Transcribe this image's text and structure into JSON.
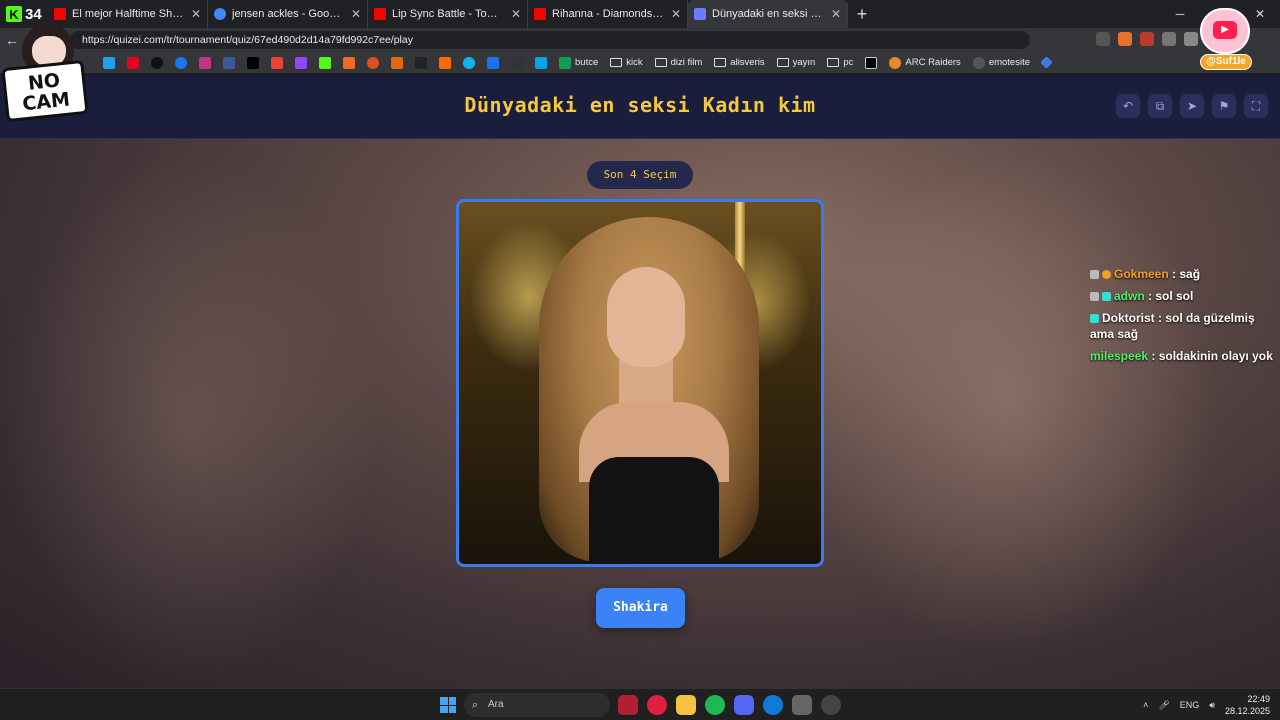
{
  "kick_badge": {
    "number": "34"
  },
  "tabs": [
    {
      "title": "El mejor Halftime Show Super Bow",
      "color": "#ff0000"
    },
    {
      "title": "jensen ackles - Google'da Ara",
      "color": "#4285f4"
    },
    {
      "title": "Lip Sync Battle - Tom Holland - Yo",
      "color": "#ff0000"
    },
    {
      "title": "Rihanna - Diamonds Live Victoria'",
      "color": "#ff0000"
    },
    {
      "title": "Dünyadaki en seksi Kadın kim - Ti",
      "color": "#6a7cff",
      "active": true
    }
  ],
  "address": {
    "url": "https://quizei.com/tr/tournament/quiz/67ed490d2d14a79fd992c7ee/play"
  },
  "bookmarks": [
    {
      "label": "butce",
      "type": "icon",
      "color": "#0f9d58"
    },
    {
      "label": "kick",
      "type": "folder"
    },
    {
      "label": "dizi film",
      "type": "folder"
    },
    {
      "label": "alisveris",
      "type": "folder"
    },
    {
      "label": "yayın",
      "type": "folder"
    },
    {
      "label": "pc",
      "type": "folder"
    },
    {
      "label": "ARC Raiders",
      "type": "icon",
      "color": "#e08a2a"
    },
    {
      "label": "emotesite",
      "type": "icon",
      "color": "#555555"
    }
  ],
  "quiz": {
    "title": "Dünyadaki en seksi Kadın kim",
    "round_label": "Son 4 Seçim",
    "candidate_name": "Shakira"
  },
  "chat": [
    {
      "user": "Gokmeen",
      "message": " : sağ"
    },
    {
      "user": "adwn",
      "message": " : sol sol"
    },
    {
      "user": "Doktorist",
      "message": " : sol da güzelmiş ama sağ"
    },
    {
      "user": "milespeek",
      "message": " : soldakinin olayı yok"
    }
  ],
  "overlay": {
    "nocam_text": "NO CAM",
    "handle": "@Suf1le"
  },
  "taskbar": {
    "search_placeholder": "Ara",
    "lang": "ENG",
    "time": "22:49",
    "date": "28.12.2025"
  }
}
